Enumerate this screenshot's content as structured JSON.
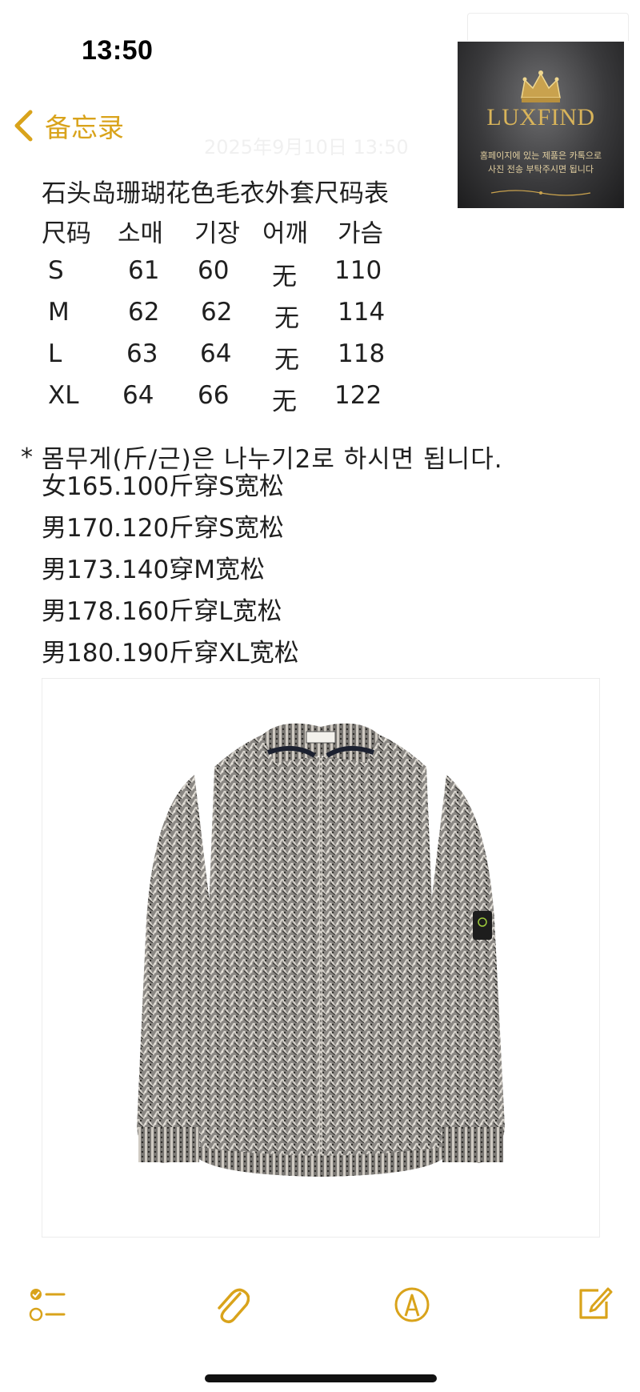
{
  "status_bar": {
    "time": "13:50"
  },
  "nav": {
    "back_label": "备忘录"
  },
  "note": {
    "faint_date": "2025年9月10日 13:50",
    "title": "石头岛珊瑚花色毛衣外套尺码表",
    "size_table": {
      "headers": [
        "尺码",
        "소매",
        "기장",
        "어깨",
        "가슴"
      ],
      "rows": [
        [
          "S",
          "61",
          "60",
          "无",
          "110"
        ],
        [
          "M",
          "62",
          "62",
          "无",
          "114"
        ],
        [
          "L",
          "63",
          "64",
          "无",
          "118"
        ],
        [
          "XL",
          "64",
          "66",
          "无",
          "122"
        ]
      ]
    },
    "weight_note": "몸무게(斤/근)은 나누기2로 하시면 됩니다.",
    "star": "*",
    "fit_lines": [
      "女165.100斤穿S宽松",
      "男170.120斤穿S宽松",
      "男173.140穿M宽松",
      "男178.160斤穿L宽松",
      "男180.190斤穿XL宽松"
    ]
  },
  "ad": {
    "brand": "LUXFIND",
    "line1": "홈페이지에 있는 제품은 카톡으로",
    "line2": "사진 전송 부탁주시면 됩니다"
  },
  "colors": {
    "accent": "#d9a31b"
  },
  "toolbar": {
    "icons": [
      "checklist-icon",
      "paperclip-icon",
      "markup-pen-icon",
      "compose-icon"
    ]
  }
}
